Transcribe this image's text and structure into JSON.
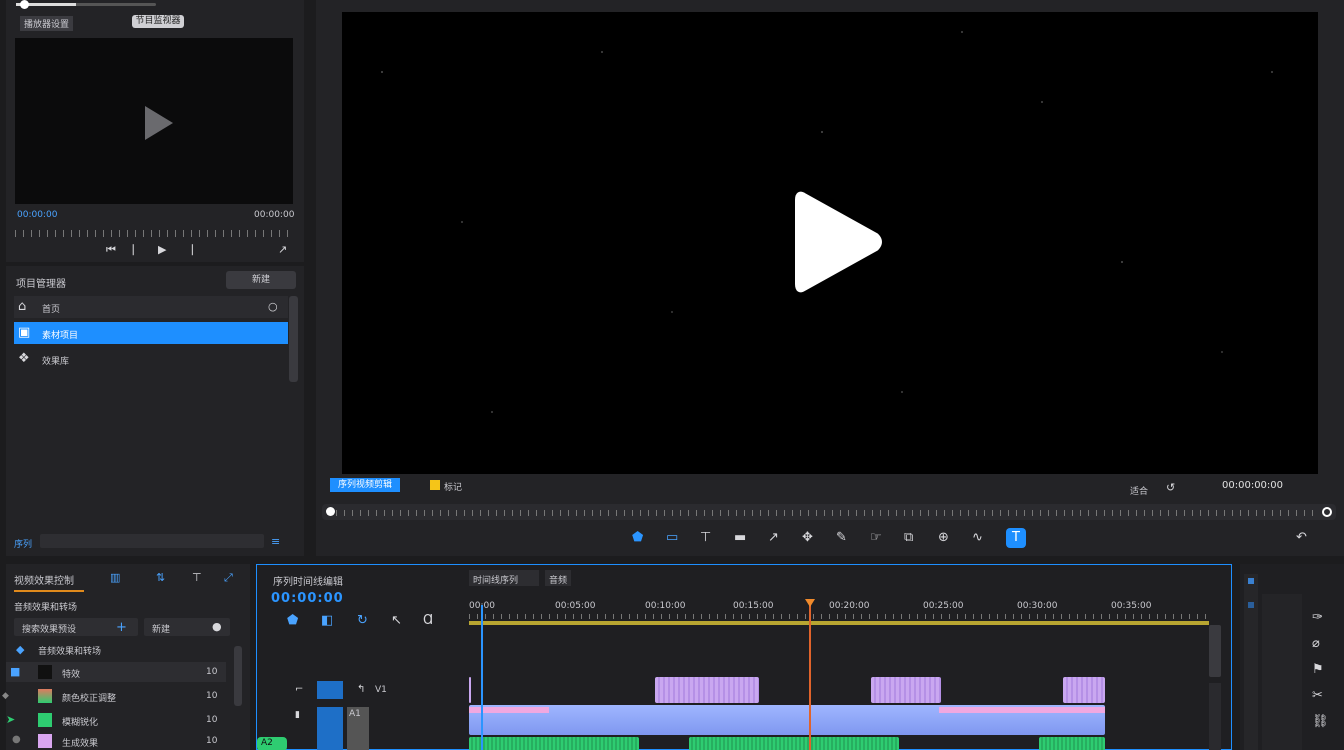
{
  "source_monitor": {
    "slider_label": "播放器设置",
    "mode_button": "节目监视器",
    "timecode_in": "00:00:00",
    "timecode_out": "00:00:00"
  },
  "project_panel": {
    "title": "项目管理器",
    "new_button": "新建",
    "items": [
      {
        "icon": "home-icon",
        "label": "首页"
      },
      {
        "icon": "folder-icon",
        "label": "素材项目"
      },
      {
        "icon": "effects-icon",
        "label": "效果库"
      }
    ],
    "footer_label": "序列"
  },
  "program_monitor": {
    "sequence_name": "序列视频剪辑",
    "marker_label": "标记",
    "fit_label": "适合",
    "timecode": "00:00:00:00"
  },
  "toolbar": {
    "tools": [
      "select-tool",
      "track-select-tool",
      "ripple-edit-tool",
      "rolling-edit-tool",
      "razor-tool",
      "slip-tool",
      "pen-tool",
      "hand-tool",
      "crop-tool",
      "zoom-tool",
      "curve-tool",
      "text-tool"
    ]
  },
  "effects_panel": {
    "title": "视频效果控制",
    "search_label": "搜索效果预设",
    "add_label": "新建",
    "category_label": "音频效果和转场",
    "rows": [
      {
        "label": "特效",
        "value": "10"
      },
      {
        "label": "颜色校正调整",
        "value": "10"
      },
      {
        "label": "模糊锐化",
        "value": "10"
      },
      {
        "label": "生成效果",
        "value": "10"
      }
    ]
  },
  "timeline": {
    "title": "序列时间线编辑",
    "tabs": [
      "时间线序列",
      "音频"
    ],
    "timecode": "00:00:00",
    "ruler_labels": [
      "00:00",
      "00:05:00",
      "00:10:00",
      "00:15:00",
      "00:20:00",
      "00:25:00",
      "00:30:00",
      "00:35:00"
    ],
    "track_labels": [
      "V1",
      "A1",
      "A2"
    ]
  }
}
